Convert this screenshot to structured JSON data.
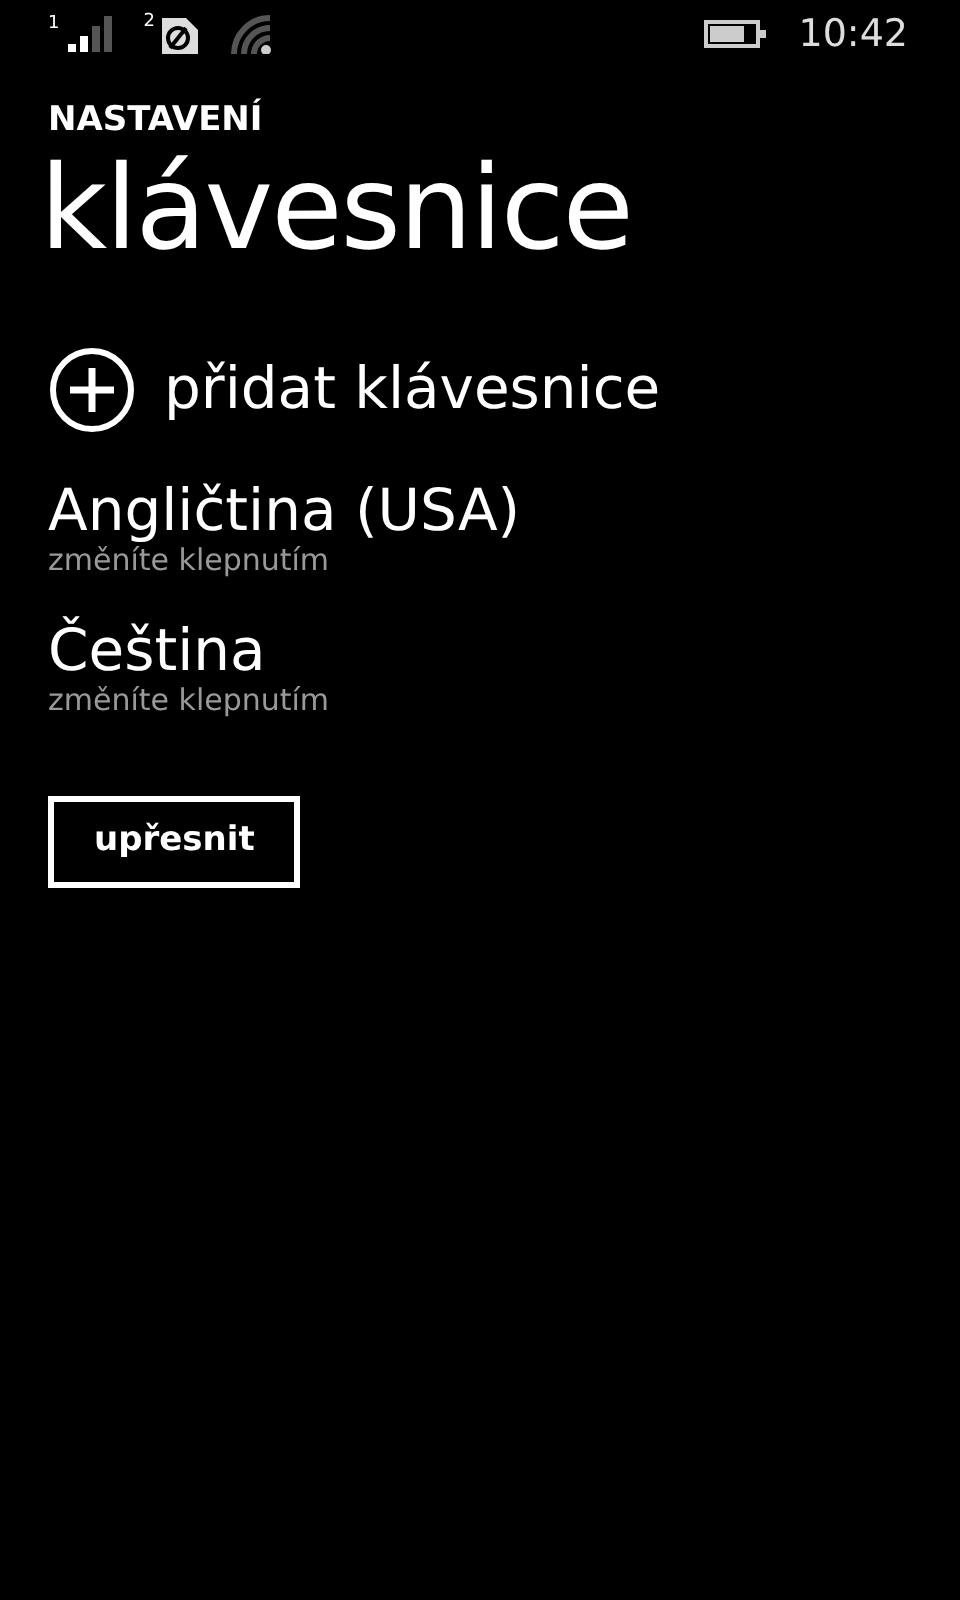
{
  "status_bar": {
    "sim_1": "1",
    "sim_2": "2",
    "time": "10:42"
  },
  "header": {
    "app_title": "NASTAVENÍ",
    "page_title": "klávesnice"
  },
  "add_keyboard": {
    "label": "přidat klávesnice"
  },
  "keyboards": [
    {
      "name": "Angličtina (USA)",
      "hint": "změníte klepnutím"
    },
    {
      "name": "Čeština",
      "hint": "změníte klepnutím"
    }
  ],
  "buttons": [
    "upřesnit"
  ]
}
